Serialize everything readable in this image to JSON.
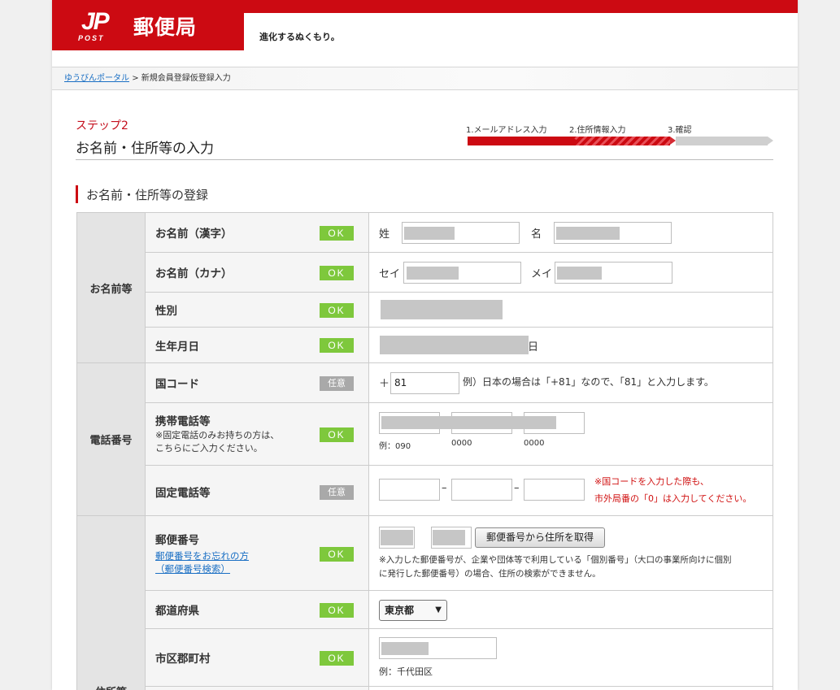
{
  "header": {
    "logo_mark": "JP",
    "logo_post": "POST",
    "logo_name": "郵便局",
    "slogan": "進化するぬくもり。"
  },
  "breadcrumb": {
    "home_link": "ゆうびんポータル",
    "separator": ">",
    "current": "新規会員登録仮登録入力"
  },
  "step": {
    "label": "ステップ2",
    "title": "お名前・住所等の入力"
  },
  "progress": {
    "steps": [
      "1.メールアドレス入力",
      "2.住所情報入力",
      "3.確認"
    ]
  },
  "section": {
    "title": "お名前・住所等の登録"
  },
  "badges": {
    "ok": "OK",
    "optional": "任意"
  },
  "groups": {
    "name": "お名前等",
    "phone": "電話番号",
    "address": "住所等"
  },
  "fields": {
    "name_kanji": {
      "label": "お名前（漢字）",
      "sei": "姓",
      "mei": "名"
    },
    "name_kana": {
      "label": "お名前（カナ）",
      "sei": "セイ",
      "mei": "メイ"
    },
    "gender": {
      "label": "性別"
    },
    "birthdate": {
      "label": "生年月日",
      "day_suffix": "日"
    },
    "country_code": {
      "label": "国コード",
      "plus": "＋",
      "value": "81",
      "hint": "例）日本の場合は「+81」なので、「81」と入力します。"
    },
    "mobile": {
      "label": "携帯電話等",
      "note1": "※固定電話のみお持ちの方は、",
      "note2": "こちらにご入力ください。",
      "example1": "例：090",
      "example2": "0000",
      "example3": "0000"
    },
    "landline": {
      "label": "固定電話等",
      "dash": "–",
      "warn1": "※国コードを入力した際も、",
      "warn2": "市外局番の「0」は入力してください。"
    },
    "postal": {
      "label": "郵便番号",
      "link1": "郵便番号をお忘れの方",
      "link2": "（郵便番号検索）",
      "button": "郵便番号から住所を取得",
      "note1": "※入力した郵便番号が、企業や団体等で利用している「個別番号」（大口の事業所向けに個別",
      "note2": "に発行した郵便番号）の場合、住所の検索ができません。"
    },
    "prefecture": {
      "label": "都道府県",
      "selected": "東京都"
    },
    "city": {
      "label": "市区郡町村",
      "example": "例：千代田区"
    }
  },
  "colors": {
    "brand_red": "#cc0a12",
    "ok_green": "#7ec83c",
    "optional_gray": "#a9a9a9",
    "link_blue": "#1a6fc4"
  }
}
